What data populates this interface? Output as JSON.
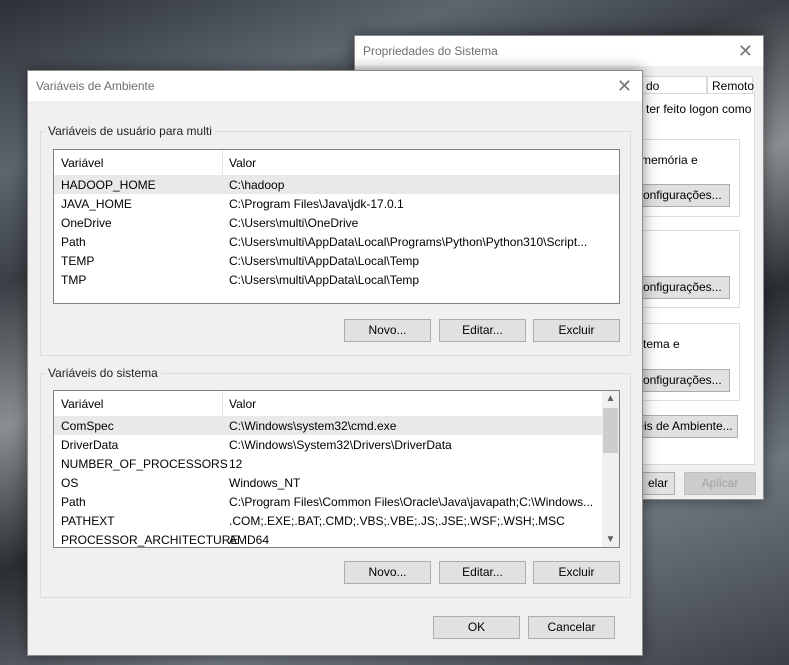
{
  "back_window": {
    "title": "Propriedades do Sistema",
    "tabs": [
      "do Sistema",
      "Remoto"
    ],
    "partial_text": [
      "ter feito logon como",
      "memória e",
      "stema e"
    ],
    "buttons": {
      "config1": "Configurações...",
      "config2": "Configurações...",
      "config3": "Configurações...",
      "env": "veis de Ambiente...",
      "cancel": "elar",
      "apply": "Aplicar"
    }
  },
  "dialog": {
    "title": "Variáveis de Ambiente",
    "user_group": {
      "label": "Variáveis de usuário para multi",
      "columns": [
        "Variável",
        "Valor"
      ],
      "rows": [
        [
          "HADOOP_HOME",
          "C:\\hadoop"
        ],
        [
          "JAVA_HOME",
          "C:\\Program Files\\Java\\jdk-17.0.1"
        ],
        [
          "OneDrive",
          "C:\\Users\\multi\\OneDrive"
        ],
        [
          "Path",
          "C:\\Users\\multi\\AppData\\Local\\Programs\\Python\\Python310\\Script..."
        ],
        [
          "TEMP",
          "C:\\Users\\multi\\AppData\\Local\\Temp"
        ],
        [
          "TMP",
          "C:\\Users\\multi\\AppData\\Local\\Temp"
        ]
      ],
      "buttons": {
        "new": "Novo...",
        "edit": "Editar...",
        "delete": "Excluir"
      }
    },
    "system_group": {
      "label": "Variáveis do sistema",
      "columns": [
        "Variável",
        "Valor"
      ],
      "rows": [
        [
          "ComSpec",
          "C:\\Windows\\system32\\cmd.exe"
        ],
        [
          "DriverData",
          "C:\\Windows\\System32\\Drivers\\DriverData"
        ],
        [
          "NUMBER_OF_PROCESSORS",
          "12"
        ],
        [
          "OS",
          "Windows_NT"
        ],
        [
          "Path",
          "C:\\Program Files\\Common Files\\Oracle\\Java\\javapath;C:\\Windows..."
        ],
        [
          "PATHEXT",
          ".COM;.EXE;.BAT;.CMD;.VBS;.VBE;.JS;.JSE;.WSF;.WSH;.MSC"
        ],
        [
          "PROCESSOR_ARCHITECTURE",
          "AMD64"
        ]
      ],
      "buttons": {
        "new": "Novo...",
        "edit": "Editar...",
        "delete": "Excluir"
      }
    },
    "ok": "OK",
    "cancel": "Cancelar"
  }
}
